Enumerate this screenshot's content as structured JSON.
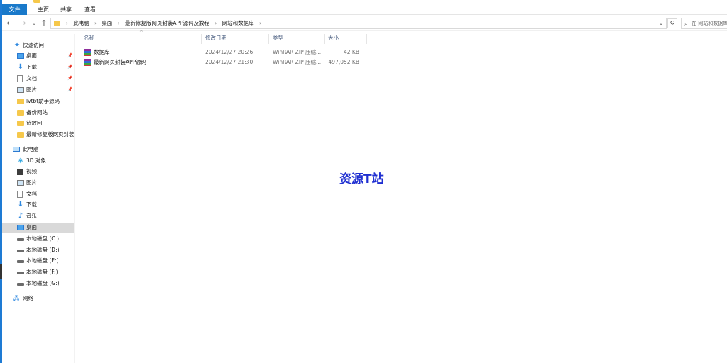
{
  "ribbon": {
    "tabs": [
      "文件",
      "主页",
      "共享",
      "查看"
    ]
  },
  "address": {
    "crumbs": [
      "此电脑",
      "桌面",
      "最新修复版网页封装APP源码及教程",
      "网站和数据库"
    ],
    "search_placeholder": "在 网站和数据库"
  },
  "sidebar": {
    "quick_access": "快速访问",
    "pinned": [
      {
        "label": "桌面",
        "icon": "desktop-icon"
      },
      {
        "label": "下载",
        "icon": "download-icon"
      },
      {
        "label": "文档",
        "icon": "document-icon"
      },
      {
        "label": "图片",
        "icon": "pictures-icon"
      }
    ],
    "folders": [
      "lvtbt助手源码",
      "备份网站",
      "待放回",
      "最新修复版网页封装"
    ],
    "this_pc": "此电脑",
    "pc_items": [
      {
        "label": "3D 对象",
        "icon": "3d-objects-icon"
      },
      {
        "label": "视频",
        "icon": "video-icon"
      },
      {
        "label": "图片",
        "icon": "pictures-icon"
      },
      {
        "label": "文档",
        "icon": "document-icon"
      },
      {
        "label": "下载",
        "icon": "download-icon"
      },
      {
        "label": "音乐",
        "icon": "music-icon"
      },
      {
        "label": "桌面",
        "icon": "desktop-icon",
        "selected": true
      }
    ],
    "drives": [
      "本地磁盘 (C:)",
      "本地磁盘 (D:)",
      "本地磁盘 (E:)",
      "本地磁盘 (F:)",
      "本地磁盘 (G:)"
    ],
    "network": "网络"
  },
  "columns": {
    "name": "名称",
    "date": "修改日期",
    "type": "类型",
    "size": "大小"
  },
  "files": [
    {
      "name": "数据库",
      "date": "2024/12/27 20:26",
      "type": "WinRAR ZIP 压缩...",
      "size": "42 KB"
    },
    {
      "name": "最新网页封装APP源码",
      "date": "2024/12/27 21:30",
      "type": "WinRAR ZIP 压缩...",
      "size": "497,052 KB"
    }
  ],
  "watermark": "资源T站",
  "colors": {
    "file_tab": "#1979ca",
    "selection": "#d9d9d9",
    "watermark": "#1f2fd1",
    "folder": "#f6c84b"
  }
}
